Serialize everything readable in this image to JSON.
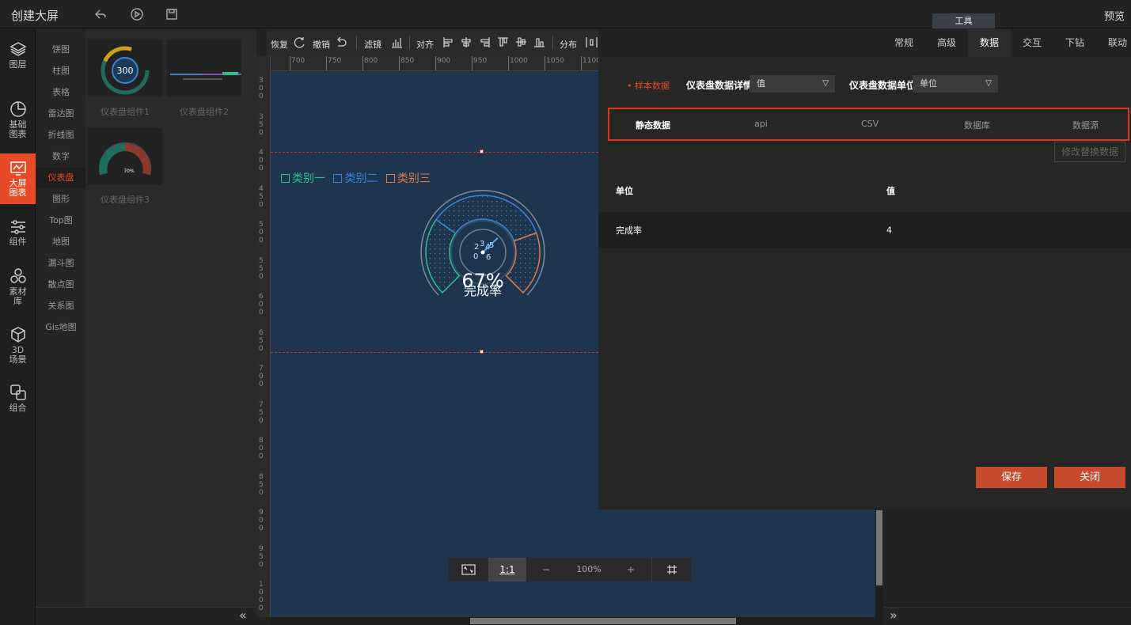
{
  "app": {
    "title": "创建大屏",
    "preview": "预览",
    "tools_tab": "工具"
  },
  "nav": [
    {
      "label": "图层",
      "icon": "layers-icon"
    },
    {
      "label": "基础图表",
      "icon": "pie-chart-icon"
    },
    {
      "label": "大屏图表",
      "icon": "screen-chart-icon"
    },
    {
      "label": "组件",
      "icon": "sliders-icon"
    },
    {
      "label": "素材库",
      "icon": "hexagons-icon"
    },
    {
      "label": "3D场景",
      "icon": "cube-icon"
    },
    {
      "label": "组合",
      "icon": "combine-icon"
    }
  ],
  "categories": [
    "饼图",
    "柱图",
    "表格",
    "雷达图",
    "折线图",
    "数字",
    "仪表盘",
    "图形",
    "Top图",
    "地图",
    "漏斗图",
    "散点图",
    "关系图",
    "Gis地图"
  ],
  "active_category": "仪表盘",
  "thumbnails": [
    {
      "label": "仪表盘组件1",
      "value": "300"
    },
    {
      "label": "仪表盘组件2"
    },
    {
      "label": "仪表盘组件3",
      "value": "70%"
    }
  ],
  "toolbar": {
    "redo": "恢复",
    "undo": "撤销",
    "filter": "滤镜",
    "align": "对齐",
    "distribute": "分布",
    "chart": "图表"
  },
  "ruler": {
    "top": [
      "700",
      "750",
      "800",
      "850",
      "900",
      "950",
      "1000",
      "1050",
      "1100"
    ],
    "left": [
      "300",
      "350",
      "400",
      "450",
      "500",
      "550",
      "600",
      "650",
      "700",
      "750",
      "800",
      "850",
      "900",
      "950",
      "1000"
    ]
  },
  "gauge": {
    "legend": [
      "类别一",
      "类别二",
      "类别三"
    ],
    "legend_colors": [
      "#2fbf8f",
      "#3b84d4",
      "#e07a45"
    ],
    "percent": 67,
    "percent_text": "67%",
    "label": "完成率",
    "needle_ticks": [
      "2",
      "3",
      "4",
      "5",
      "0",
      "6"
    ]
  },
  "zoom": {
    "ratio": "1:1",
    "level": "100%"
  },
  "panel": {
    "tabs": [
      "常规",
      "高级",
      "数据",
      "交互",
      "下钻",
      "联动"
    ],
    "active_tab": "数据",
    "sample_label": "样本数据",
    "detail_label": "仪表盘数据详情",
    "detail_value": "值",
    "unit_label": "仪表盘数据单位",
    "unit_value": "单位",
    "data_tabs": [
      "静态数据",
      "api",
      "CSV",
      "数据库",
      "数据源"
    ],
    "modify_button": "修改替换数据",
    "table": {
      "headers": [
        "单位",
        "值"
      ],
      "rows": [
        [
          "完成率",
          "4"
        ]
      ]
    },
    "save": "保存",
    "close": "关闭"
  }
}
